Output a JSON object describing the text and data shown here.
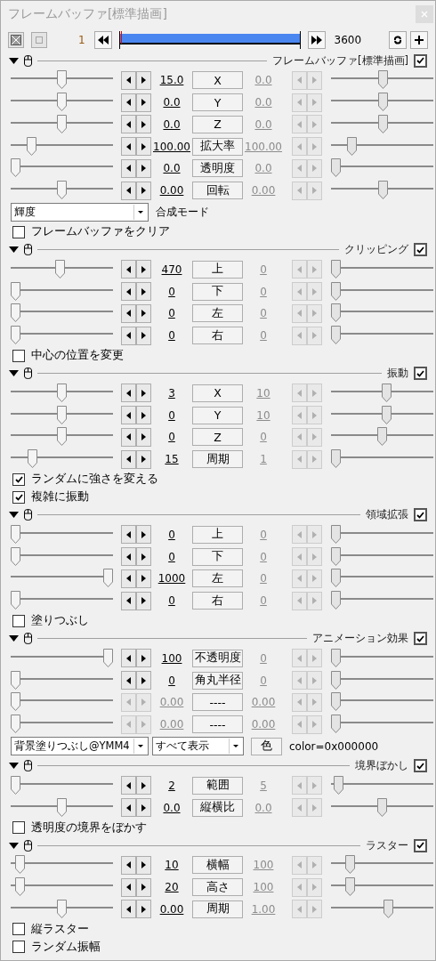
{
  "window": {
    "title": "フレームバッファ[標準描画]"
  },
  "timeline": {
    "start": "1",
    "end": "3600"
  },
  "sections": [
    {
      "name": "フレームバッファ[標準描画]",
      "enabled": true,
      "params": [
        {
          "label": "X",
          "disabled": false,
          "start": {
            "value": "15.0",
            "level": 0.5
          },
          "end": {
            "value": "0.0",
            "level": 0.51,
            "active": false
          }
        },
        {
          "label": "Y",
          "disabled": false,
          "start": {
            "value": "0.0",
            "level": 0.5
          },
          "end": {
            "value": "0.0",
            "level": 0.51,
            "active": false
          }
        },
        {
          "label": "Z",
          "disabled": false,
          "start": {
            "value": "0.0",
            "level": 0.5
          },
          "end": {
            "value": "0.0",
            "level": 0.51,
            "active": false
          }
        },
        {
          "label": "拡大率",
          "disabled": false,
          "start": {
            "value": "100.00",
            "level": 0.17
          },
          "end": {
            "value": "100.00",
            "level": 0.17,
            "active": false
          }
        },
        {
          "label": "透明度",
          "disabled": false,
          "start": {
            "value": "0.0",
            "level": 0
          },
          "end": {
            "value": "0.0",
            "level": 0,
            "active": false
          }
        },
        {
          "label": "回転",
          "disabled": false,
          "start": {
            "value": "0.00",
            "level": 0.5
          },
          "end": {
            "value": "0.00",
            "level": 0.51,
            "active": false
          }
        }
      ],
      "extras": [
        {
          "kind": "combo",
          "items": [
            {
              "kind": "select",
              "value": "輝度",
              "wide": true
            },
            {
              "kind": "text",
              "text": "合成モード"
            }
          ]
        },
        {
          "kind": "checkbox",
          "label": "フレームバッファをクリア",
          "checked": false
        }
      ]
    },
    {
      "name": "クリッピング",
      "enabled": true,
      "params": [
        {
          "label": "上",
          "disabled": false,
          "start": {
            "value": "470",
            "level": 0.48
          },
          "end": {
            "value": "0",
            "level": 0,
            "active": false
          }
        },
        {
          "label": "下",
          "disabled": false,
          "start": {
            "value": "0",
            "level": 0
          },
          "end": {
            "value": "0",
            "level": 0,
            "active": false
          }
        },
        {
          "label": "左",
          "disabled": false,
          "start": {
            "value": "0",
            "level": 0
          },
          "end": {
            "value": "0",
            "level": 0,
            "active": false
          }
        },
        {
          "label": "右",
          "disabled": false,
          "start": {
            "value": "0",
            "level": 0
          },
          "end": {
            "value": "0",
            "level": 0,
            "active": false
          }
        }
      ],
      "extras": [
        {
          "kind": "checkbox",
          "label": "中心の位置を変更",
          "checked": false
        }
      ]
    },
    {
      "name": "振動",
      "enabled": true,
      "params": [
        {
          "label": "X",
          "disabled": false,
          "start": {
            "value": "3",
            "level": 0.5
          },
          "end": {
            "value": "10",
            "level": 0.55,
            "active": false
          }
        },
        {
          "label": "Y",
          "disabled": false,
          "start": {
            "value": "0",
            "level": 0.5
          },
          "end": {
            "value": "10",
            "level": 0.55,
            "active": false
          }
        },
        {
          "label": "Z",
          "disabled": false,
          "start": {
            "value": "0",
            "level": 0.5
          },
          "end": {
            "value": "0",
            "level": 0.5,
            "active": false
          }
        },
        {
          "label": "周期",
          "disabled": false,
          "start": {
            "value": "15",
            "level": 0.18
          },
          "end": {
            "value": "1",
            "level": 0,
            "active": false
          }
        }
      ],
      "extras": [
        {
          "kind": "checkbox",
          "label": "ランダムに強さを変える",
          "checked": true
        },
        {
          "kind": "checkbox",
          "label": "複雑に振動",
          "checked": true
        }
      ]
    },
    {
      "name": "領域拡張",
      "enabled": true,
      "params": [
        {
          "label": "上",
          "disabled": false,
          "start": {
            "value": "0",
            "level": 0
          },
          "end": {
            "value": "0",
            "level": 0,
            "active": false
          }
        },
        {
          "label": "下",
          "disabled": false,
          "start": {
            "value": "0",
            "level": 0
          },
          "end": {
            "value": "0",
            "level": 0,
            "active": false
          }
        },
        {
          "label": "左",
          "disabled": false,
          "start": {
            "value": "1000",
            "level": 1
          },
          "end": {
            "value": "0",
            "level": 0,
            "active": false
          }
        },
        {
          "label": "右",
          "disabled": false,
          "start": {
            "value": "0",
            "level": 0
          },
          "end": {
            "value": "0",
            "level": 0,
            "active": false
          }
        }
      ],
      "extras": [
        {
          "kind": "checkbox",
          "label": "塗りつぶし",
          "checked": false
        }
      ]
    },
    {
      "name": "アニメーション効果",
      "enabled": true,
      "params": [
        {
          "label": "不透明度",
          "disabled": false,
          "start": {
            "value": "100",
            "level": 1
          },
          "end": {
            "value": "0",
            "level": 0,
            "active": false
          }
        },
        {
          "label": "角丸半径",
          "disabled": false,
          "start": {
            "value": "0",
            "level": 0
          },
          "end": {
            "value": "0",
            "level": 0,
            "active": false
          }
        },
        {
          "label": "----",
          "disabled": true,
          "start": {
            "value": "0.00",
            "level": 0
          },
          "end": {
            "value": "0.00",
            "level": 0,
            "active": false
          }
        },
        {
          "label": "----",
          "disabled": true,
          "start": {
            "value": "0.00",
            "level": 0
          },
          "end": {
            "value": "0.00",
            "level": 0,
            "active": false
          }
        }
      ],
      "extras": [
        {
          "kind": "combo",
          "items": [
            {
              "kind": "select",
              "value": "背景塗りつぶし@YMM4",
              "wide": true
            },
            {
              "kind": "select",
              "value": "すべて表示",
              "wide": false
            },
            {
              "kind": "button",
              "label": "色"
            },
            {
              "kind": "text",
              "text": "color=0x000000"
            }
          ]
        }
      ]
    },
    {
      "name": "境界ぼかし",
      "enabled": true,
      "params": [
        {
          "label": "範囲",
          "disabled": false,
          "start": {
            "value": "2",
            "level": 0
          },
          "end": {
            "value": "5",
            "level": 0.03,
            "active": false
          }
        },
        {
          "label": "縦横比",
          "disabled": false,
          "start": {
            "value": "0.0",
            "level": 0.5
          },
          "end": {
            "value": "0.0",
            "level": 0.5,
            "active": false
          }
        }
      ],
      "extras": [
        {
          "kind": "checkbox",
          "label": "透明度の境界をぼかす",
          "checked": false
        }
      ]
    },
    {
      "name": "ラスター",
      "enabled": true,
      "params": [
        {
          "label": "横幅",
          "disabled": false,
          "start": {
            "value": "10",
            "level": 0.05
          },
          "end": {
            "value": "100",
            "level": 0.15,
            "active": false
          }
        },
        {
          "label": "高さ",
          "disabled": false,
          "start": {
            "value": "20",
            "level": 0.05
          },
          "end": {
            "value": "100",
            "level": 0.15,
            "active": false
          }
        },
        {
          "label": "周期",
          "disabled": false,
          "start": {
            "value": "0.00",
            "level": 0.5
          },
          "end": {
            "value": "1.00",
            "level": 0.57,
            "active": false
          }
        }
      ],
      "extras": [
        {
          "kind": "checkbox",
          "label": "縦ラスター",
          "checked": false
        },
        {
          "kind": "checkbox",
          "label": "ランダム振幅",
          "checked": false
        }
      ]
    }
  ]
}
